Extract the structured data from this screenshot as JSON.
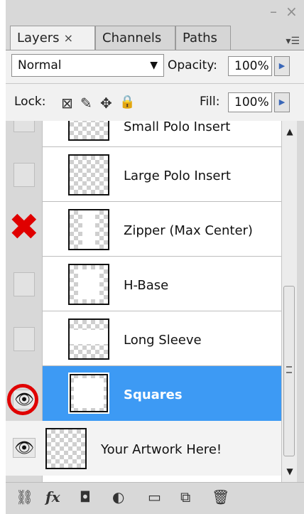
{
  "tabs": [
    {
      "label": "Layers",
      "close": "×"
    },
    {
      "label": "Channels"
    },
    {
      "label": "Paths"
    }
  ],
  "window_controls": {
    "minimize": "–",
    "close": "×"
  },
  "toolbar": {
    "blend_mode": "Normal",
    "opacity_label": "Opacity:",
    "opacity_value": "100%",
    "lock_label": "Lock:",
    "fill_label": "Fill:",
    "fill_value": "100%"
  },
  "layers": [
    {
      "name": "Small Polo Insert",
      "visible": false
    },
    {
      "name": "Large Polo Insert",
      "visible": false
    },
    {
      "name": "Zipper (Max Center)",
      "visible": false,
      "annotation": "red-x"
    },
    {
      "name": "H-Base",
      "visible": false
    },
    {
      "name": "Long Sleeve",
      "visible": false
    },
    {
      "name": "Squares",
      "visible": true,
      "selected": true,
      "annotation": "red-circle"
    },
    {
      "name": "Your Artwork Here!",
      "visible": true
    }
  ],
  "icons": {
    "lock_transparent": "transparency-lock-icon",
    "lock_image": "brush-lock-icon",
    "lock_position": "move-lock-icon",
    "lock_all": "padlock-icon",
    "footer": [
      "link-icon",
      "fx-icon",
      "mask-icon",
      "adjustment-icon",
      "folder-icon",
      "new-layer-icon",
      "trash-icon"
    ]
  },
  "colors": {
    "selection": "#3d9af4",
    "annotation": "#e00000"
  }
}
